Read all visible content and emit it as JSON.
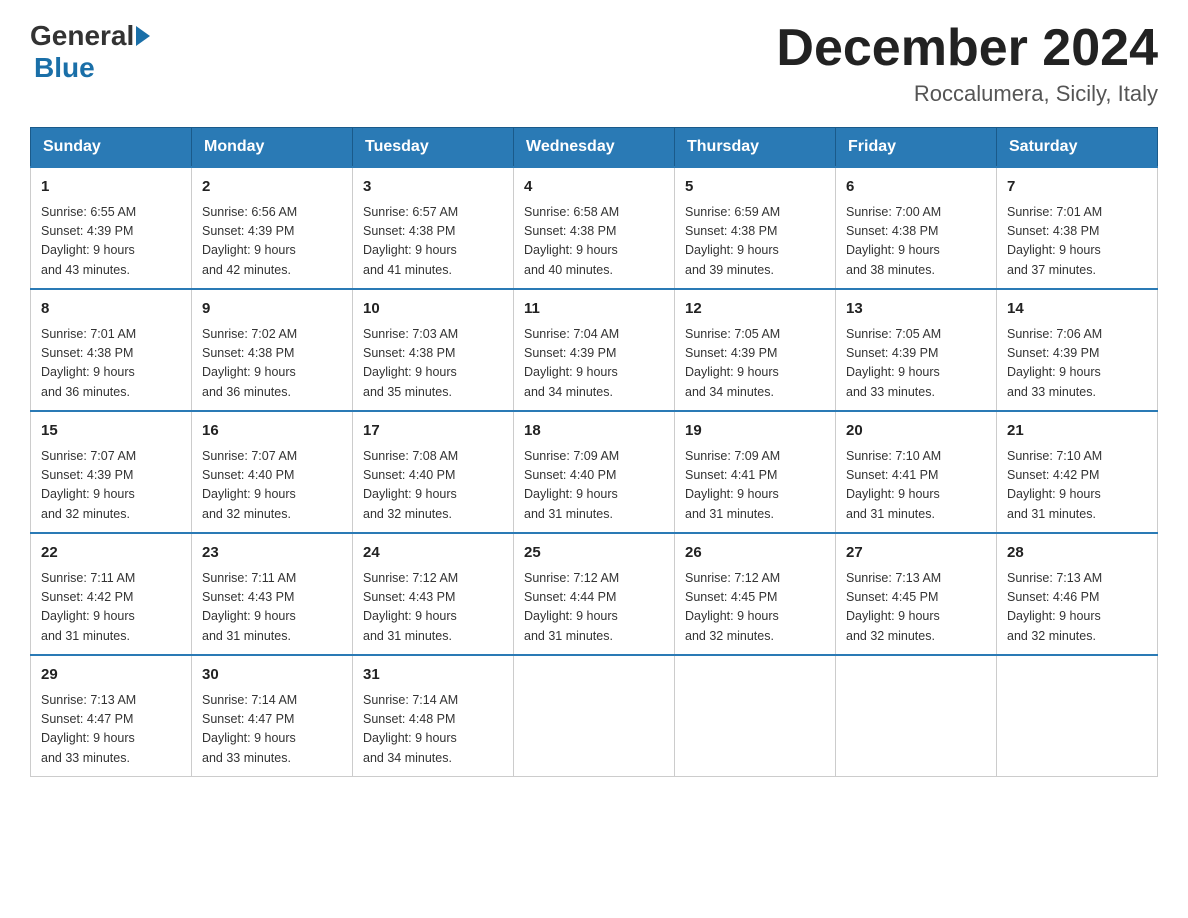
{
  "header": {
    "logo": {
      "general": "General",
      "blue": "Blue"
    },
    "title": "December 2024",
    "location": "Roccalumera, Sicily, Italy"
  },
  "days_of_week": [
    "Sunday",
    "Monday",
    "Tuesday",
    "Wednesday",
    "Thursday",
    "Friday",
    "Saturday"
  ],
  "weeks": [
    [
      {
        "day": "1",
        "sunrise": "6:55 AM",
        "sunset": "4:39 PM",
        "daylight": "9 hours and 43 minutes."
      },
      {
        "day": "2",
        "sunrise": "6:56 AM",
        "sunset": "4:39 PM",
        "daylight": "9 hours and 42 minutes."
      },
      {
        "day": "3",
        "sunrise": "6:57 AM",
        "sunset": "4:38 PM",
        "daylight": "9 hours and 41 minutes."
      },
      {
        "day": "4",
        "sunrise": "6:58 AM",
        "sunset": "4:38 PM",
        "daylight": "9 hours and 40 minutes."
      },
      {
        "day": "5",
        "sunrise": "6:59 AM",
        "sunset": "4:38 PM",
        "daylight": "9 hours and 39 minutes."
      },
      {
        "day": "6",
        "sunrise": "7:00 AM",
        "sunset": "4:38 PM",
        "daylight": "9 hours and 38 minutes."
      },
      {
        "day": "7",
        "sunrise": "7:01 AM",
        "sunset": "4:38 PM",
        "daylight": "9 hours and 37 minutes."
      }
    ],
    [
      {
        "day": "8",
        "sunrise": "7:01 AM",
        "sunset": "4:38 PM",
        "daylight": "9 hours and 36 minutes."
      },
      {
        "day": "9",
        "sunrise": "7:02 AM",
        "sunset": "4:38 PM",
        "daylight": "9 hours and 36 minutes."
      },
      {
        "day": "10",
        "sunrise": "7:03 AM",
        "sunset": "4:38 PM",
        "daylight": "9 hours and 35 minutes."
      },
      {
        "day": "11",
        "sunrise": "7:04 AM",
        "sunset": "4:39 PM",
        "daylight": "9 hours and 34 minutes."
      },
      {
        "day": "12",
        "sunrise": "7:05 AM",
        "sunset": "4:39 PM",
        "daylight": "9 hours and 34 minutes."
      },
      {
        "day": "13",
        "sunrise": "7:05 AM",
        "sunset": "4:39 PM",
        "daylight": "9 hours and 33 minutes."
      },
      {
        "day": "14",
        "sunrise": "7:06 AM",
        "sunset": "4:39 PM",
        "daylight": "9 hours and 33 minutes."
      }
    ],
    [
      {
        "day": "15",
        "sunrise": "7:07 AM",
        "sunset": "4:39 PM",
        "daylight": "9 hours and 32 minutes."
      },
      {
        "day": "16",
        "sunrise": "7:07 AM",
        "sunset": "4:40 PM",
        "daylight": "9 hours and 32 minutes."
      },
      {
        "day": "17",
        "sunrise": "7:08 AM",
        "sunset": "4:40 PM",
        "daylight": "9 hours and 32 minutes."
      },
      {
        "day": "18",
        "sunrise": "7:09 AM",
        "sunset": "4:40 PM",
        "daylight": "9 hours and 31 minutes."
      },
      {
        "day": "19",
        "sunrise": "7:09 AM",
        "sunset": "4:41 PM",
        "daylight": "9 hours and 31 minutes."
      },
      {
        "day": "20",
        "sunrise": "7:10 AM",
        "sunset": "4:41 PM",
        "daylight": "9 hours and 31 minutes."
      },
      {
        "day": "21",
        "sunrise": "7:10 AM",
        "sunset": "4:42 PM",
        "daylight": "9 hours and 31 minutes."
      }
    ],
    [
      {
        "day": "22",
        "sunrise": "7:11 AM",
        "sunset": "4:42 PM",
        "daylight": "9 hours and 31 minutes."
      },
      {
        "day": "23",
        "sunrise": "7:11 AM",
        "sunset": "4:43 PM",
        "daylight": "9 hours and 31 minutes."
      },
      {
        "day": "24",
        "sunrise": "7:12 AM",
        "sunset": "4:43 PM",
        "daylight": "9 hours and 31 minutes."
      },
      {
        "day": "25",
        "sunrise": "7:12 AM",
        "sunset": "4:44 PM",
        "daylight": "9 hours and 31 minutes."
      },
      {
        "day": "26",
        "sunrise": "7:12 AM",
        "sunset": "4:45 PM",
        "daylight": "9 hours and 32 minutes."
      },
      {
        "day": "27",
        "sunrise": "7:13 AM",
        "sunset": "4:45 PM",
        "daylight": "9 hours and 32 minutes."
      },
      {
        "day": "28",
        "sunrise": "7:13 AM",
        "sunset": "4:46 PM",
        "daylight": "9 hours and 32 minutes."
      }
    ],
    [
      {
        "day": "29",
        "sunrise": "7:13 AM",
        "sunset": "4:47 PM",
        "daylight": "9 hours and 33 minutes."
      },
      {
        "day": "30",
        "sunrise": "7:14 AM",
        "sunset": "4:47 PM",
        "daylight": "9 hours and 33 minutes."
      },
      {
        "day": "31",
        "sunrise": "7:14 AM",
        "sunset": "4:48 PM",
        "daylight": "9 hours and 34 minutes."
      },
      null,
      null,
      null,
      null
    ]
  ],
  "labels": {
    "sunrise": "Sunrise:",
    "sunset": "Sunset:",
    "daylight": "Daylight:"
  }
}
